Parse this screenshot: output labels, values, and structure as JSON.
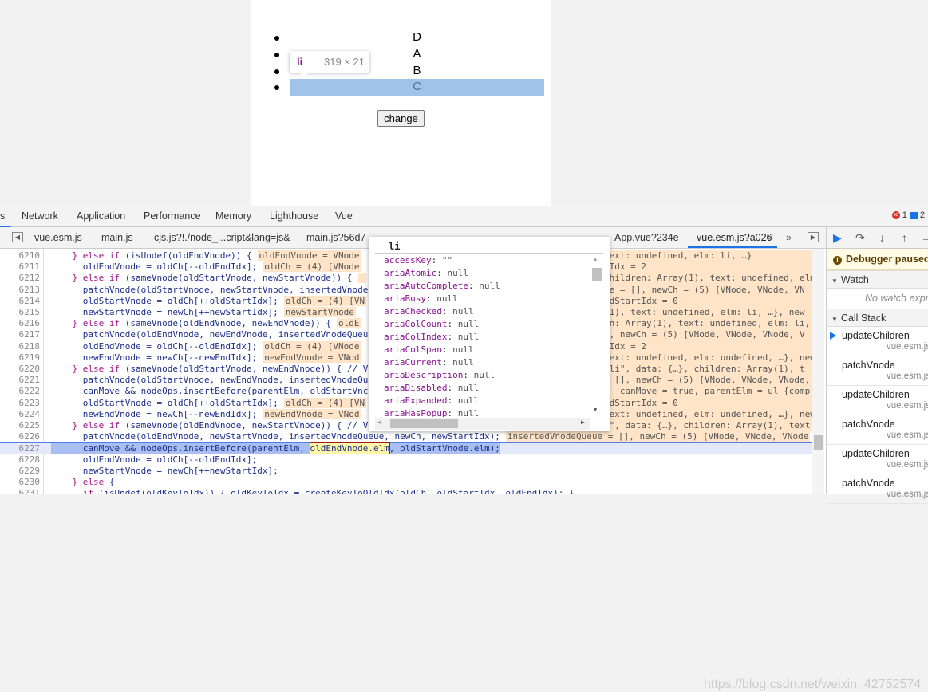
{
  "page": {
    "list_items": [
      "D",
      "A",
      "B",
      "C"
    ],
    "highlighted_index": 3,
    "button_label": "change",
    "tooltip": {
      "tag": "li",
      "dimensions": "319 × 21"
    }
  },
  "devtools": {
    "tabs": [
      {
        "label": "s"
      },
      {
        "label": "Network"
      },
      {
        "label": "Application"
      },
      {
        "label": "Performance"
      },
      {
        "label": "Memory"
      },
      {
        "label": "Lighthouse"
      },
      {
        "label": "Vue"
      }
    ],
    "error_count": "1",
    "message_count": "2",
    "file_tabs": [
      "vue.esm.js",
      "main.js",
      "cjs.js?!./node_...cript&lang=js&",
      "main.js?56d7",
      "App.vue?234e",
      "vue.esm.js?a026"
    ],
    "active_file": "vue.esm.js?a026",
    "close_label": "×",
    "more_label": "»",
    "code_lines": [
      {
        "n": "6210",
        "kw": "    } else if ",
        "code": "(isUndef(oldEndVnode)) {",
        "anno": "oldEndVnode = VNode",
        "right": "text: undefined, elm: li, …}",
        "ro": true
      },
      {
        "n": "6211",
        "code": "      oldEndVnode = oldCh[--oldEndIdx];",
        "anno": "oldCh = (4) [VNode",
        "right": "dIdx = 2",
        "ro": true
      },
      {
        "n": "6212",
        "kw": "    } else if ",
        "code": "(sameVnode(oldStartVnode, newStartVnode)) {",
        "anno": " ",
        "right": "children: Array(1), text: undefined, elm",
        "ro": true
      },
      {
        "n": "6213",
        "code": "      patchVnode(oldStartVnode, newStartVnode, insertedVnode",
        "right": "ue = [], newCh = (5) [VNode, VNode, VN",
        "ro": true
      },
      {
        "n": "6214",
        "code": "      oldStartVnode = oldCh[++oldStartIdx];",
        "anno": "oldCh = (4) [VN",
        "right": "ldStartIdx = 0",
        "ro": true
      },
      {
        "n": "6215",
        "code": "      newStartVnode = newCh[++newStartIdx];",
        "anno": "newStartVnode",
        "right": "(1), text: undefined, elm: li, …}, new",
        "ro": true
      },
      {
        "n": "6216",
        "kw": "    } else if ",
        "code": "(sameVnode(oldEndVnode, newEndVnode)) {",
        "anno": "oldE",
        "right": "en: Array(1), text: undefined, elm: li,",
        "ro": true
      },
      {
        "n": "6217",
        "code": "      patchVnode(oldEndVnode, newEndVnode, insertedVnodeQueu",
        "right": "], newCh = (5) [VNode, VNode, VNode, V",
        "ro": true
      },
      {
        "n": "6218",
        "code": "      oldEndVnode = oldCh[--oldEndIdx];",
        "anno": "oldCh = (4) [VNode",
        "right": "dIdx = 2",
        "ro": true
      },
      {
        "n": "6219",
        "code": "      newEndVnode = newCh[--newEndIdx];",
        "anno": "newEndVnode = VNod",
        "right": "text: undefined, elm: undefined, …}, new",
        "ro": true
      },
      {
        "n": "6220",
        "kw": "    } else if ",
        "code": "(sameVnode(oldStartVnode, newEndVnode)) { // V",
        "right": "\"li\", data: {…}, children: Array(1), t",
        "ro": true
      },
      {
        "n": "6221",
        "code": "      patchVnode(oldStartVnode, newEndVnode, insertedVnodeQu",
        "right": "= [], newCh = (5) [VNode, VNode, VNode,",
        "ro": true
      },
      {
        "n": "6222",
        "code": "      canMove && nodeOps.insertBefore(parentElm, oldStartVnc",
        "right": ";  canMove = true, parentElm = ul {comp",
        "ro": true
      },
      {
        "n": "6223",
        "code": "      oldStartVnode = oldCh[++oldStartIdx];",
        "anno": "oldCh = (4) [VN",
        "right": "ldStartIdx = 0",
        "ro": true
      },
      {
        "n": "6224",
        "code": "      newEndVnode = newCh[--newEndIdx];",
        "anno": "newEndVnode = VNod",
        "right": "text: undefined, elm: undefined, …}, new",
        "ro": true
      },
      {
        "n": "6225",
        "kw": "    } else if ",
        "code": "(sameVnode(oldEndVnode, newStartVnode)) { // V",
        "right": "i\", data: {…}, children: Array(1), text",
        "ro": true
      },
      {
        "n": "6226",
        "code": "      patchVnode(oldEndVnode, newStartVnode, insertedVnodeQueue, newCh, newStartIdx);",
        "anno": "insertedVnodeQueue = [], newCh = (5) [VNode, VNode, VNode"
      },
      {
        "n": "6227",
        "current": true,
        "pre": "      canMove && nodeOps.insertBefore(parentElm, ",
        "boxed": "oldEndVnode.elm",
        "post": ", oldStartVnode.elm);"
      },
      {
        "n": "6228",
        "code": "      oldEndVnode = oldCh[--oldEndIdx];"
      },
      {
        "n": "6229",
        "code": "      newStartVnode = newCh[++newStartIdx];"
      },
      {
        "n": "6230",
        "kw": "    } else ",
        "code": "{"
      },
      {
        "n": "6231",
        "kw": "      if ",
        "code": "(isUndef(oldKeyToIdx)) { oldKeyToIdx = createKeyToOldIdx(oldCh, oldStartIdx, oldEndIdx); }"
      }
    ],
    "popup": {
      "title": "li",
      "properties": [
        {
          "key": "accessKey",
          "value": "\"\""
        },
        {
          "key": "ariaAtomic",
          "value": "null"
        },
        {
          "key": "ariaAutoComplete",
          "value": "null"
        },
        {
          "key": "ariaBusy",
          "value": "null"
        },
        {
          "key": "ariaChecked",
          "value": "null"
        },
        {
          "key": "ariaColCount",
          "value": "null"
        },
        {
          "key": "ariaColIndex",
          "value": "null"
        },
        {
          "key": "ariaColSpan",
          "value": "null"
        },
        {
          "key": "ariaCurrent",
          "value": "null"
        },
        {
          "key": "ariaDescription",
          "value": "null"
        },
        {
          "key": "ariaDisabled",
          "value": "null"
        },
        {
          "key": "ariaExpanded",
          "value": "null"
        },
        {
          "key": "ariaHasPopup",
          "value": "null"
        }
      ]
    },
    "sidebar": {
      "paused_label": "Debugger paused",
      "watch_label": "Watch",
      "no_watch": "No watch expressions",
      "call_stack_label": "Call Stack",
      "frames": [
        {
          "fn": "updateChildren",
          "file": "vue.esm.js"
        },
        {
          "fn": "patchVnode",
          "file": "vue.esm.js"
        },
        {
          "fn": "updateChildren",
          "file": "vue.esm.js"
        },
        {
          "fn": "patchVnode",
          "file": "vue.esm.js"
        },
        {
          "fn": "updateChildren",
          "file": "vue.esm.js"
        },
        {
          "fn": "patchVnode",
          "file": "vue.esm.js"
        }
      ]
    },
    "watermark": "https://blog.csdn.net/weixin_42752574"
  }
}
